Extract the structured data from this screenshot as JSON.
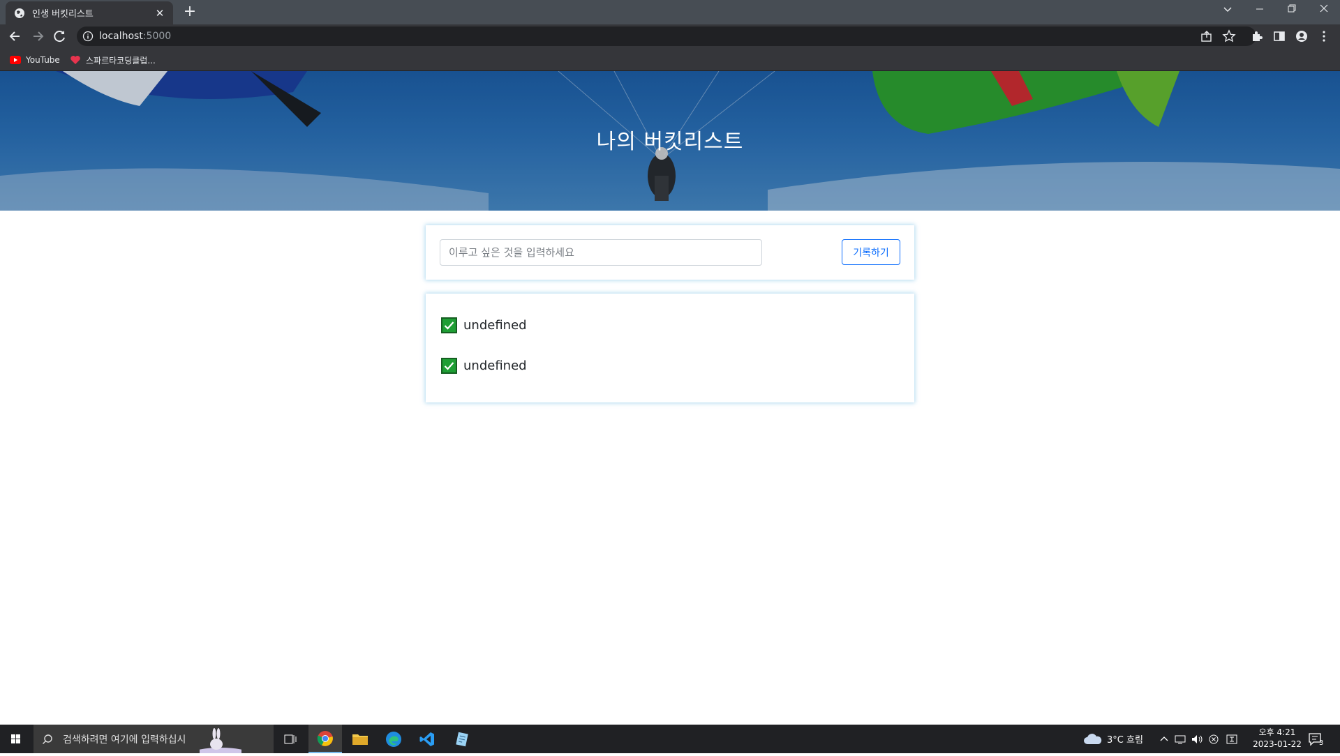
{
  "browser": {
    "tab_title": "인생 버킷리스트",
    "tab_close": "✕",
    "new_tab": "+",
    "url_host": "localhost",
    "url_port": ":5000",
    "bookmarks": [
      "YouTube",
      "스파르타코딩클럽..."
    ]
  },
  "page": {
    "title": "나의 버킷리스트",
    "input_placeholder": "이루고 싶은 것을 입력하세요",
    "submit_label": "기록하기",
    "items": [
      "undefined",
      "undefined"
    ]
  },
  "taskbar": {
    "search_placeholder": "검색하려면 여기에 입력하십시",
    "weather": "3°C  흐림",
    "time": "오후 4:21",
    "date": "2023-01-22",
    "notification_count": "3"
  },
  "colors": {
    "accent": "#0d6efd",
    "check": "#1e9e34",
    "hero_sky": "#2c72b8"
  }
}
